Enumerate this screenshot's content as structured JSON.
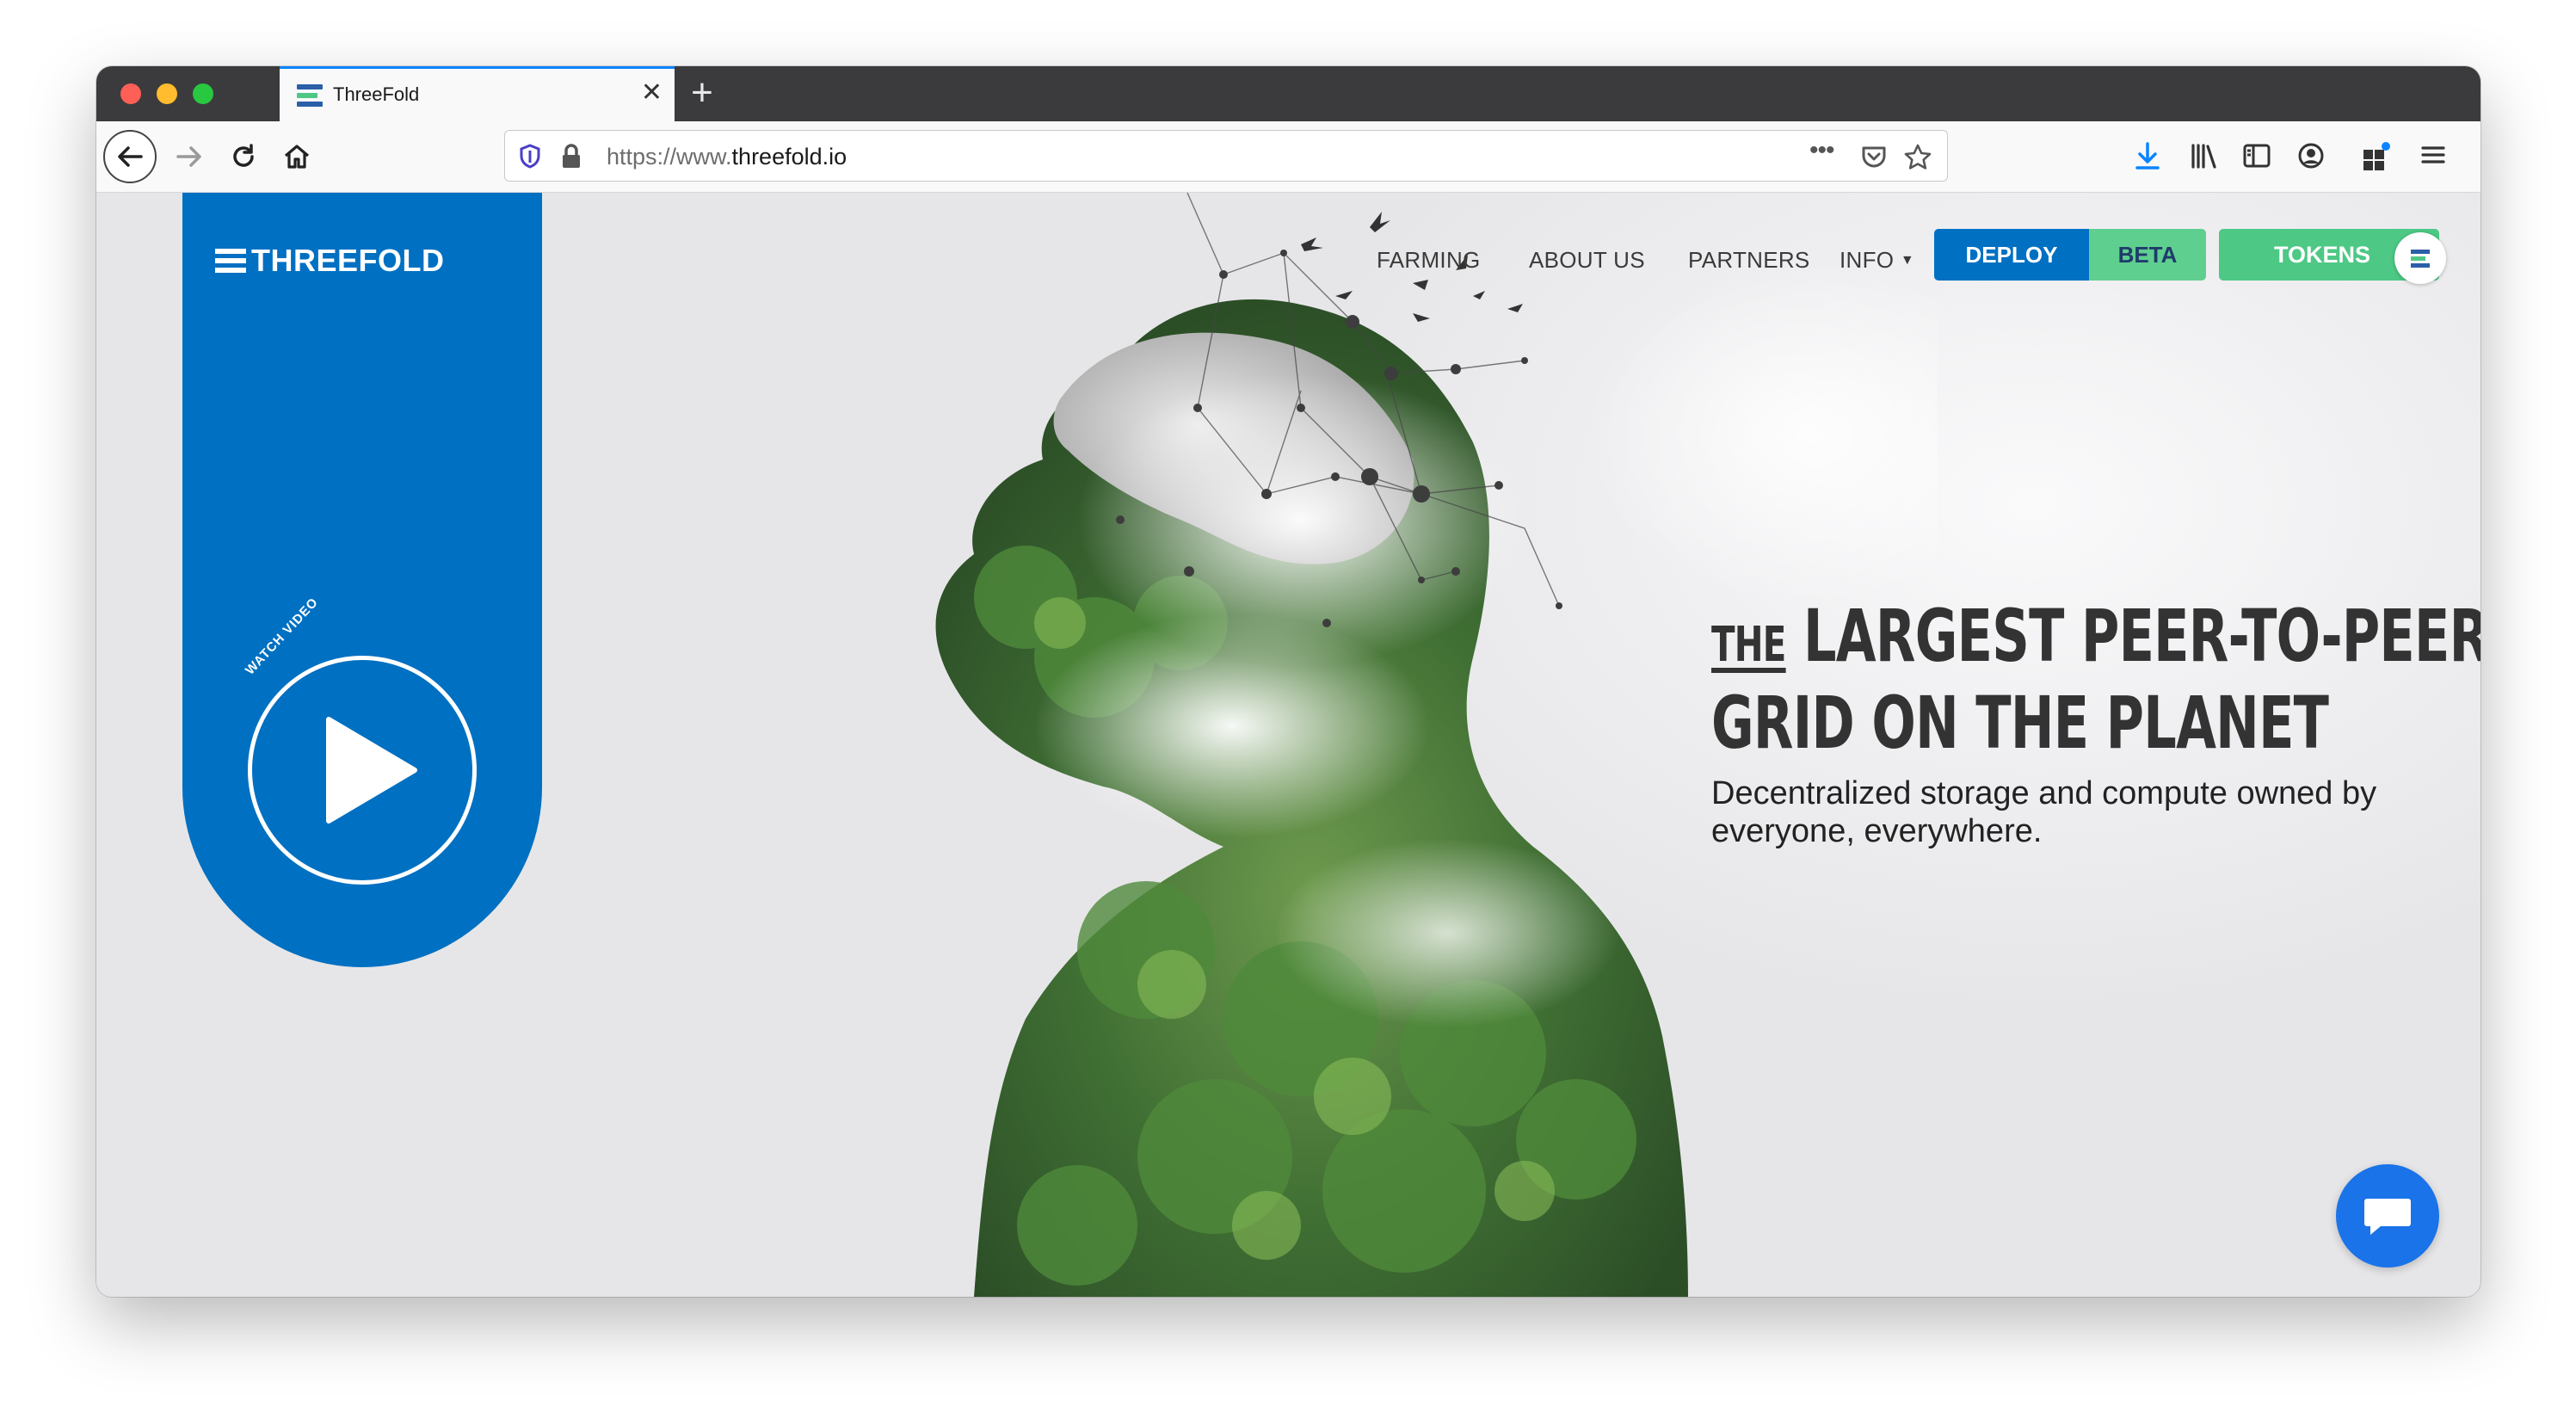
{
  "browser": {
    "tab_title": "ThreeFold",
    "new_tab_icon": "plus-icon",
    "url_prefix": "https://www.",
    "url_domain": "threefold.io"
  },
  "site": {
    "logo_text": "THREEFOLD",
    "watch_label": "WATCH VIDEO",
    "nav": {
      "farming": "FARMING",
      "about": "ABOUT US",
      "partners": "PARTNERS",
      "info": "INFO"
    },
    "deploy_label": "DEPLOY",
    "beta_label": "BETA",
    "tokens_label": "TOKENS",
    "hero_the": "THE",
    "hero_line1": "LARGEST PEER-TO-PEER",
    "hero_line2": "GRID ON THE PLANET",
    "hero_sub": "Decentralized storage and compute owned by everyone, everywhere."
  },
  "colors": {
    "brand_blue": "#0070c2",
    "brand_green": "#4dc885",
    "chat_blue": "#1a73e8",
    "tab_accent": "#0a84ff"
  }
}
